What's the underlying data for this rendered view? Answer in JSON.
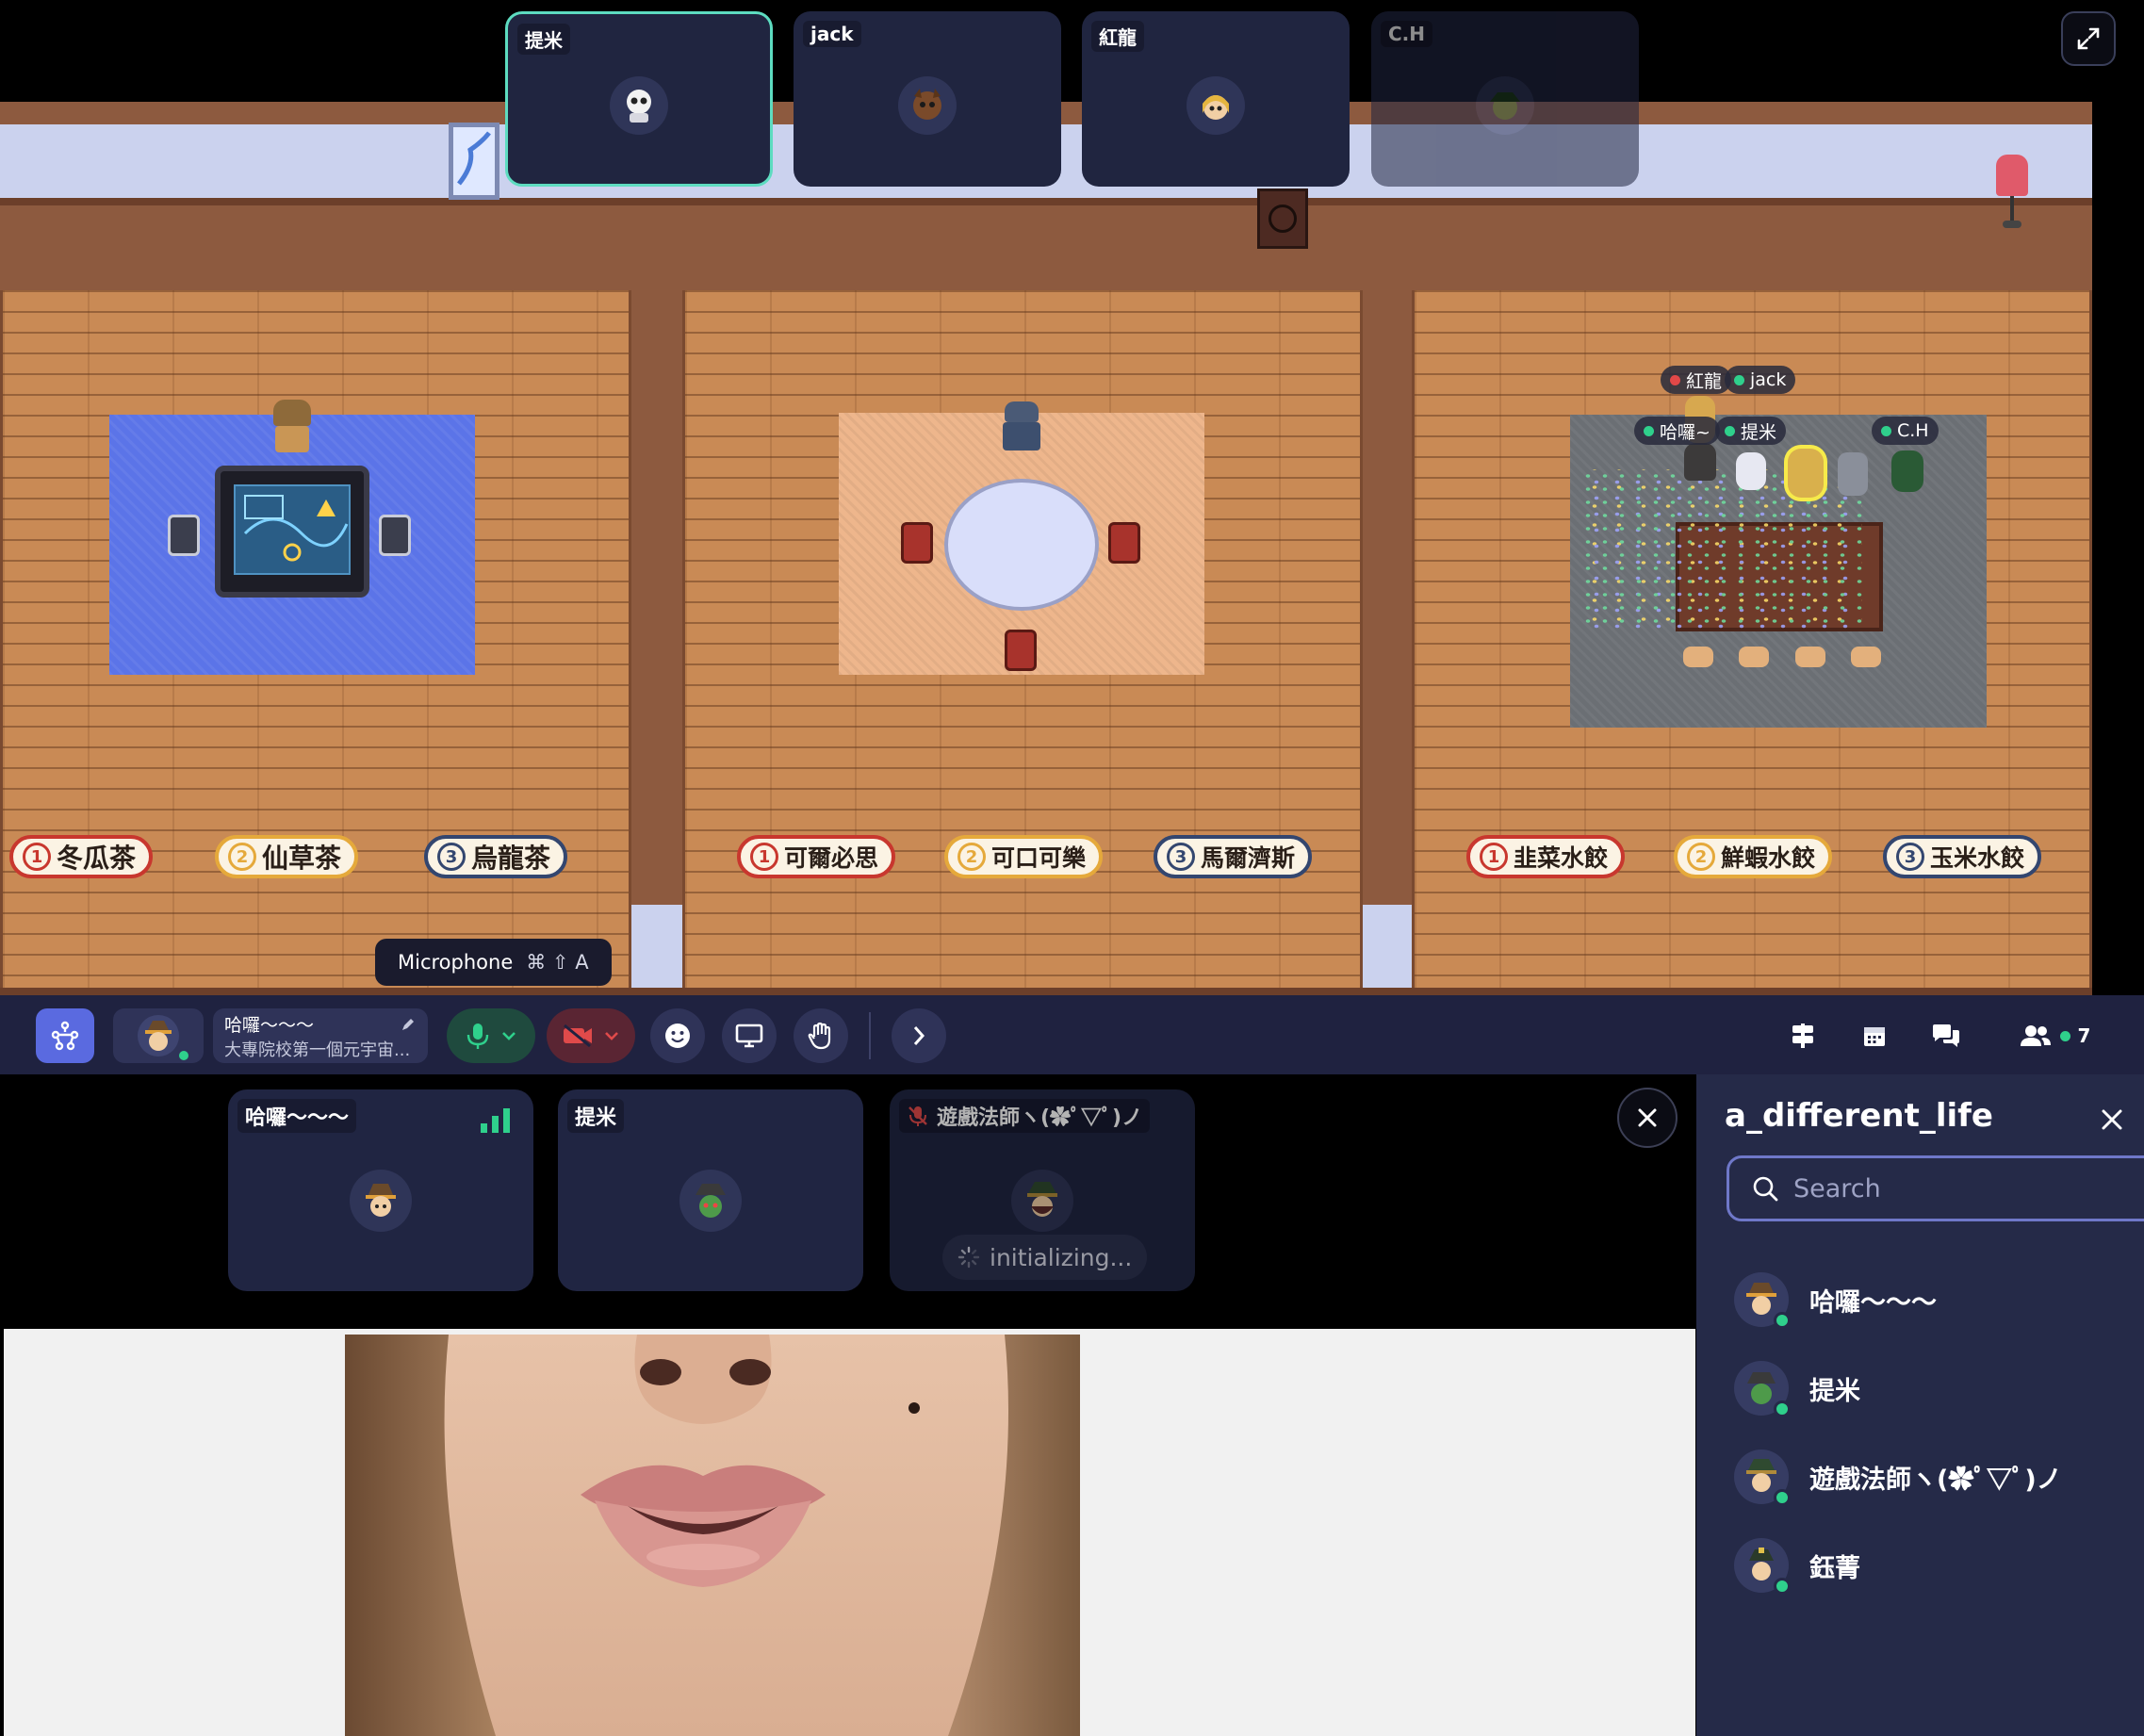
{
  "video_strip": [
    {
      "label": "提米",
      "state": "active"
    },
    {
      "label": "jack",
      "state": "normal"
    },
    {
      "label": "紅龍",
      "state": "normal"
    },
    {
      "label": "C.H",
      "state": "faded"
    }
  ],
  "signs": [
    {
      "num": "1",
      "text": "冬瓜茶"
    },
    {
      "num": "2",
      "text": "仙草茶"
    },
    {
      "num": "3",
      "text": "烏龍茶"
    },
    {
      "num": "1",
      "text": "可爾必思"
    },
    {
      "num": "2",
      "text": "可口可樂"
    },
    {
      "num": "3",
      "text": "馬爾濟斯"
    },
    {
      "num": "1",
      "text": "韭菜水餃"
    },
    {
      "num": "2",
      "text": "鮮蝦水餃"
    },
    {
      "num": "3",
      "text": "玉米水餃"
    }
  ],
  "map_tags": {
    "honglong": "紅龍",
    "jack": "jack",
    "halo": "哈囉~",
    "timi": "提米",
    "ch": "C.H"
  },
  "tooltip": {
    "label": "Microphone",
    "shortcut": "⌘ ⇧ A"
  },
  "profile": {
    "name": "哈囉～～～",
    "status": "大專院校第一個元宇宙..."
  },
  "toolbar": {
    "online_count": "7"
  },
  "call_tiles": [
    {
      "label": "哈囉～～～"
    },
    {
      "label": "提米"
    },
    {
      "label": "遊戲法師ヽ(✿ﾟ▽ﾟ)ノ"
    }
  ],
  "call_status": "initializing...",
  "side_panel": {
    "title": "a_different_life",
    "search_placeholder": "Search",
    "members": [
      {
        "name": "哈囉～～～"
      },
      {
        "name": "提米"
      },
      {
        "name": "遊戲法師ヽ(✿ﾟ▽ﾟ)ノ"
      },
      {
        "name": "鈺菁"
      }
    ]
  },
  "colors": {
    "toolbar_bg": "#1f2240",
    "tile_bg": "#202540",
    "mic_green": "#2fd08c",
    "cam_red": "#e04a4a",
    "accent_blue": "#5a6ae0"
  }
}
